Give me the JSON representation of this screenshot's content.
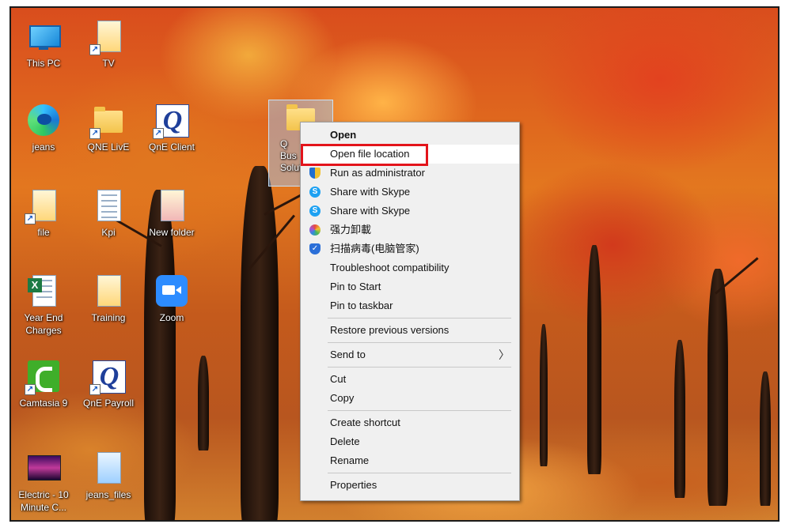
{
  "desktop": {
    "icons": [
      {
        "label": "This PC",
        "icon": "computer-icon"
      },
      {
        "label": "TV",
        "icon": "file-icon"
      },
      {
        "label": "jeans",
        "icon": "edge-icon"
      },
      {
        "label": "QNE LivE",
        "icon": "folder-icon"
      },
      {
        "label": "QnE Client",
        "icon": "qne-icon"
      },
      {
        "label": "file",
        "icon": "file-icon"
      },
      {
        "label": "Kpi",
        "icon": "document-icon"
      },
      {
        "label": "New folder",
        "icon": "folder-icon"
      },
      {
        "label": "Year End Charges",
        "icon": "excel-icon"
      },
      {
        "label": "Training",
        "icon": "file-icon"
      },
      {
        "label": "Zoom",
        "icon": "zoom-icon"
      },
      {
        "label": "Camtasia 9",
        "icon": "camtasia-icon"
      },
      {
        "label": "QnE Payroll",
        "icon": "qne-icon"
      },
      {
        "label": "Electric - 10 Minute C...",
        "icon": "video-icon"
      },
      {
        "label": "jeans_files",
        "icon": "file-icon"
      }
    ],
    "selected_icon": {
      "label": "Q\nBus\nSolut",
      "icon": "folder-icon"
    }
  },
  "context_menu": {
    "items": {
      "open": "Open",
      "open_file_location": "Open file location",
      "run_as_admin": "Run as administrator",
      "share_skype_1": "Share with Skype",
      "share_skype_2": "Share with Skype",
      "force_uninstall": "强力卸載",
      "scan_virus": "扫描病毒(电脑管家)",
      "troubleshoot": "Troubleshoot compatibility",
      "pin_start": "Pin to Start",
      "pin_taskbar": "Pin to taskbar",
      "restore_versions": "Restore previous versions",
      "send_to": "Send to",
      "cut": "Cut",
      "copy": "Copy",
      "create_shortcut": "Create shortcut",
      "delete": "Delete",
      "rename": "Rename",
      "properties": "Properties"
    },
    "highlight_color": "#e3141b"
  }
}
